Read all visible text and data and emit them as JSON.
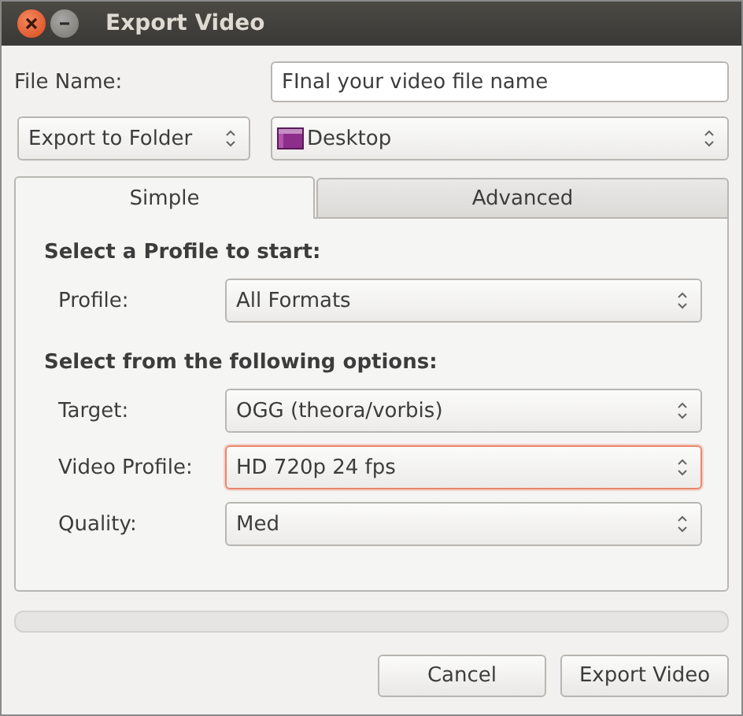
{
  "window": {
    "title": "Export Video"
  },
  "file_name": {
    "label": "File Name:",
    "value": "FInal your video file name"
  },
  "export_mode": {
    "value": "Export to Folder"
  },
  "folder": {
    "value": "Desktop"
  },
  "tabs": [
    {
      "label": "Simple",
      "selected": true
    },
    {
      "label": "Advanced",
      "selected": false
    }
  ],
  "sections": [
    {
      "heading": "Select a Profile to start:",
      "fields": [
        {
          "label": "Profile:",
          "value": "All Formats",
          "focused": false
        }
      ]
    },
    {
      "heading": "Select from the following options:",
      "fields": [
        {
          "label": "Target:",
          "value": "OGG (theora/vorbis)",
          "focused": false
        },
        {
          "label": "Video Profile:",
          "value": "HD 720p 24 fps",
          "focused": true
        },
        {
          "label": "Quality:",
          "value": "Med",
          "focused": false
        }
      ]
    }
  ],
  "progress": {
    "level": 0
  },
  "buttons": [
    "Cancel",
    "Export Video"
  ]
}
